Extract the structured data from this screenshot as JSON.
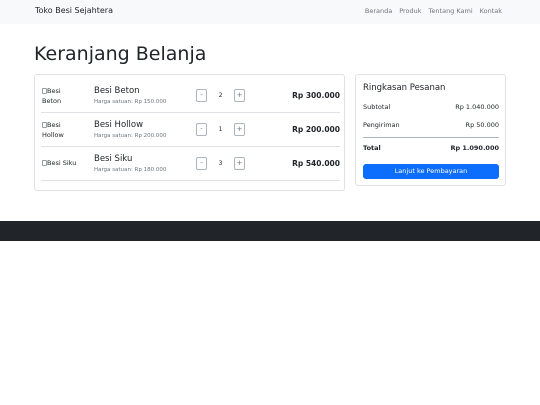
{
  "navbar": {
    "brand": "Toko Besi Sejahtera",
    "links": [
      "Beranda",
      "Produk",
      "Tentang Kami",
      "Kontak"
    ]
  },
  "page": {
    "title": "Keranjang Belanja"
  },
  "cart": {
    "items": [
      {
        "img_alt": "Besi Beton",
        "img_alt_line1": "Besi",
        "img_alt_line2": "Beton",
        "name": "Besi Beton",
        "unit_price": "Harga satuan: Rp 150.000",
        "qty": "2",
        "total": "Rp 300.000"
      },
      {
        "img_alt": "Besi Hollow",
        "img_alt_line1": "Besi",
        "img_alt_line2": "Hollow",
        "name": "Besi Hollow",
        "unit_price": "Harga satuan: Rp 200.000",
        "qty": "1",
        "total": "Rp 200.000"
      },
      {
        "img_alt": "Besi Siku",
        "img_alt_line1": "Besi Siku",
        "img_alt_line2": "",
        "name": "Besi Siku",
        "unit_price": "Harga satuan: Rp 180.000",
        "qty": "3",
        "total": "Rp 540.000"
      }
    ],
    "minus_label": "-",
    "plus_label": "+"
  },
  "summary": {
    "title": "Ringkasan Pesanan",
    "subtotal_label": "Subtotal",
    "subtotal_value": "Rp 1.040.000",
    "shipping_label": "Pengiriman",
    "shipping_value": "Rp 50.000",
    "total_label": "Total",
    "total_value": "Rp 1.090.000",
    "checkout_label": "Lanjut ke Pembayaran"
  },
  "colors": {
    "primary": "#0d6efd",
    "navbar_bg": "#f8f9fa",
    "footer_bg": "#212529"
  }
}
